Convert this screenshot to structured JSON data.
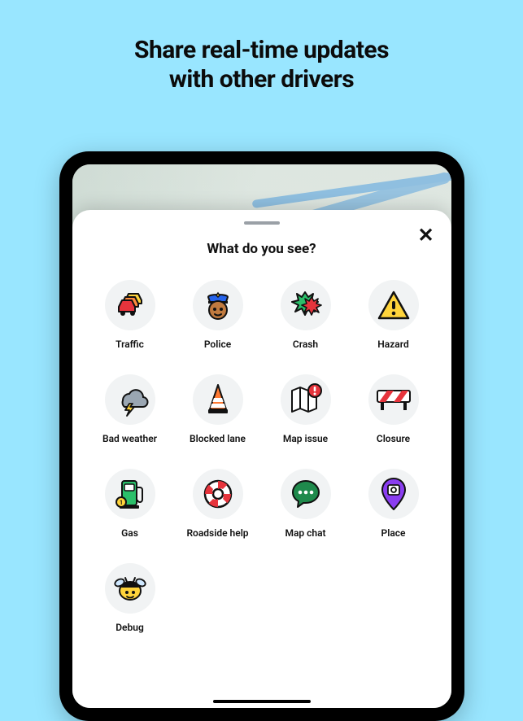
{
  "headline_line1": "Share real-time updates",
  "headline_line2": "with other drivers",
  "sheet": {
    "title": "What do you see?",
    "close_symbol": "✕"
  },
  "reports": [
    {
      "id": "traffic",
      "label": "Traffic"
    },
    {
      "id": "police",
      "label": "Police"
    },
    {
      "id": "crash",
      "label": "Crash"
    },
    {
      "id": "hazard",
      "label": "Hazard"
    },
    {
      "id": "bad-weather",
      "label": "Bad weather"
    },
    {
      "id": "blocked-lane",
      "label": "Blocked lane"
    },
    {
      "id": "map-issue",
      "label": "Map issue"
    },
    {
      "id": "closure",
      "label": "Closure"
    },
    {
      "id": "gas",
      "label": "Gas"
    },
    {
      "id": "roadside-help",
      "label": "Roadside help"
    },
    {
      "id": "map-chat",
      "label": "Map chat"
    },
    {
      "id": "place",
      "label": "Place"
    },
    {
      "id": "debug",
      "label": "Debug"
    }
  ]
}
